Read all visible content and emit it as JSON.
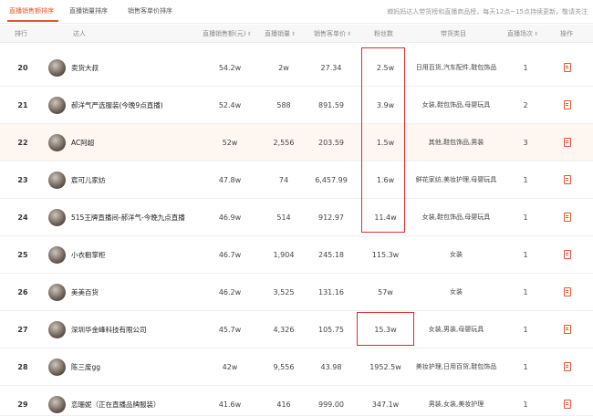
{
  "tabs": [
    "直播销售额排序",
    "直播销量排序",
    "销售客单价排序"
  ],
  "notice": "蝉妈妈达人带货榜和直播商品榜，每天12点~15点持续更新，敬请关注",
  "columns": {
    "rank": "排行",
    "talent": "达人",
    "sales": "直播销售额(元)",
    "volume": "直播销量",
    "price": "销售客单价",
    "fans": "粉丝数",
    "categories": "带货类目",
    "lives": "直播场次",
    "operation": "操作"
  },
  "rows": [
    {
      "rank": "20",
      "name": "卖货大叔",
      "sales": "54.2w",
      "volume": "2w",
      "price": "27.34",
      "fans": "2.5w",
      "categories": "日用百货,汽车配件,鞋包饰品",
      "lives": "1"
    },
    {
      "rank": "21",
      "name": "郝洋气严选服装(今晚9点直播)",
      "sales": "52.4w",
      "volume": "588",
      "price": "891.59",
      "fans": "3.9w",
      "categories": "女装,鞋包饰品,母婴玩具",
      "lives": "2"
    },
    {
      "rank": "22",
      "name": "AC阿超",
      "sales": "52w",
      "volume": "2,556",
      "price": "203.59",
      "fans": "1.5w",
      "categories": "其他,鞋包饰品,男装",
      "lives": "3"
    },
    {
      "rank": "23",
      "name": "宸可儿家纺",
      "sales": "47.8w",
      "volume": "74",
      "price": "6,457.99",
      "fans": "1.6w",
      "categories": "鲜花家纺,美妆护理,母婴玩具",
      "lives": "1"
    },
    {
      "rank": "24",
      "name": "515王牌直播间-郝洋气-今晚九点直播",
      "sales": "46.9w",
      "volume": "514",
      "price": "912.97",
      "fans": "11.4w",
      "categories": "女装,鞋包饰品,母婴玩具",
      "lives": "1"
    },
    {
      "rank": "25",
      "name": "小衣橱掌柜",
      "sales": "46.7w",
      "volume": "1,904",
      "price": "245.18",
      "fans": "115.3w",
      "categories": "女装",
      "lives": "1"
    },
    {
      "rank": "26",
      "name": "美美百货",
      "sales": "46.2w",
      "volume": "3,525",
      "price": "131.16",
      "fans": "57w",
      "categories": "女装",
      "lives": "1"
    },
    {
      "rank": "27",
      "name": "深圳华金峰科技有限公司",
      "sales": "45.7w",
      "volume": "4,326",
      "price": "105.75",
      "fans": "15.3w",
      "categories": "女装,男装,母婴玩具",
      "lives": "1"
    },
    {
      "rank": "28",
      "name": "陈三废gg",
      "sales": "42w",
      "volume": "9,556",
      "price": "43.98",
      "fans": "1952.5w",
      "categories": "美妆护理,日用百货,鞋包饰品",
      "lives": "1"
    },
    {
      "rank": "29",
      "name": "恋珊妮（正在直播品牌服装）",
      "sales": "41.6w",
      "volume": "416",
      "price": "999.00",
      "fans": "347.1w",
      "categories": "男装,女装,美妆护理",
      "lives": "1"
    }
  ],
  "icons": {
    "sort": "sort-arrow-icon",
    "operation": "detail-icon",
    "avatar": "avatar-image"
  },
  "colors": {
    "accent": "#e8532d",
    "highlight_row": "#fdf6f1",
    "annotation_box": "#e32a2a"
  }
}
